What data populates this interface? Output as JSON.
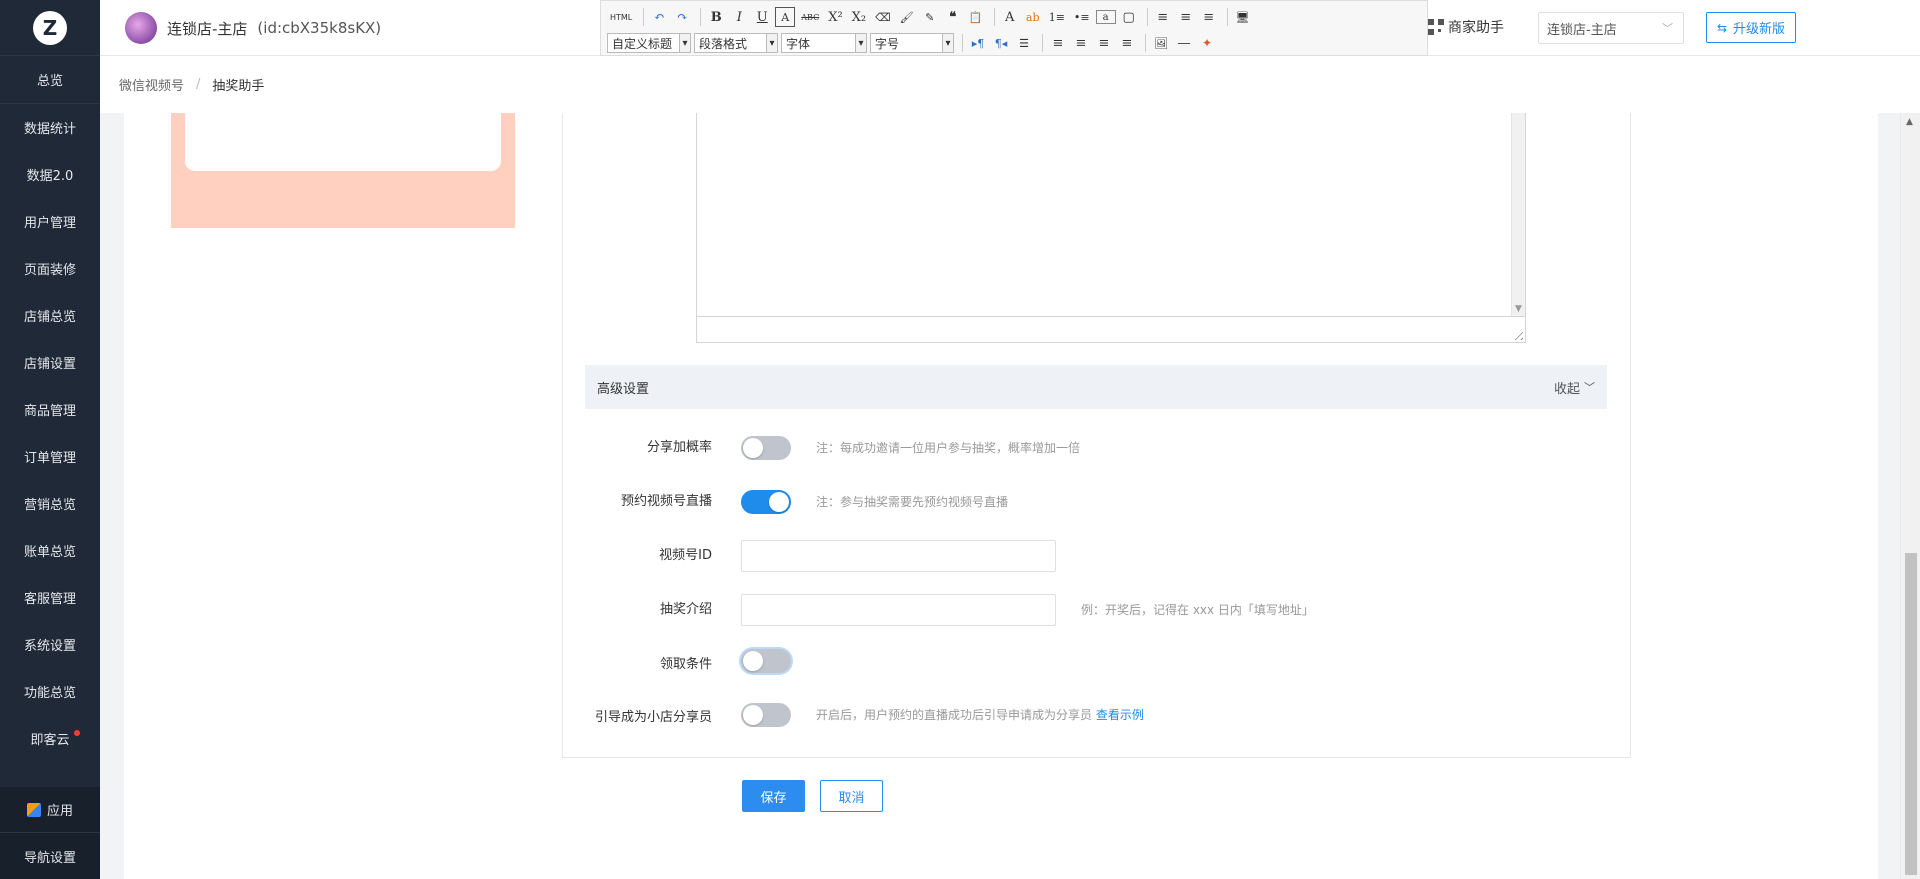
{
  "sidebar": {
    "logo_letter": "Z",
    "items": [
      {
        "label": "总览"
      },
      {
        "label": "数据统计"
      },
      {
        "label": "数据2.0"
      },
      {
        "label": "用户管理"
      },
      {
        "label": "页面装修"
      },
      {
        "label": "店铺总览"
      },
      {
        "label": "店铺设置"
      },
      {
        "label": "商品管理"
      },
      {
        "label": "订单管理"
      },
      {
        "label": "营销总览"
      },
      {
        "label": "账单总览"
      },
      {
        "label": "客服管理"
      },
      {
        "label": "系统设置"
      },
      {
        "label": "功能总览"
      },
      {
        "label": "即客云"
      }
    ],
    "bottom": {
      "app_label": "应用",
      "nav_settings_label": "导航设置"
    }
  },
  "header": {
    "shop_name": "连锁店-主店",
    "shop_id": "(id:cbX35k8sKX)",
    "helper_label": "商家助手",
    "store_selector_value": "连锁店-主店",
    "upgrade_label": "升级新版"
  },
  "editor_toolbar": {
    "row1": [
      "HTML",
      "↶",
      "↷",
      "B",
      "I",
      "U",
      "A",
      "ABC",
      "X²",
      "X₂",
      "⌫",
      "🖌",
      "✎",
      "❝",
      "📋",
      "A",
      "ab",
      "1≡",
      "•≡",
      "a",
      "▢",
      "≡",
      "≡",
      "≡",
      "🖥"
    ],
    "row2_selects": [
      "自定义标题",
      "段落格式",
      "字体",
      "字号"
    ],
    "row2_buttons": [
      "▸¶",
      "¶◂",
      "☰",
      "≡",
      "≡",
      "≡",
      "≡",
      "🖼",
      "—",
      "✦"
    ]
  },
  "breadcrumb": {
    "parent": "微信视频号",
    "separator": "/",
    "current": "抽奖助手"
  },
  "advanced": {
    "title": "高级设置",
    "collapse_label": "收起"
  },
  "fields": {
    "share_boost": {
      "label": "分享加概率",
      "on": false,
      "note": "注：每成功邀请一位用户参与抽奖，概率增加一倍"
    },
    "reserve_live": {
      "label": "预约视频号直播",
      "on": true,
      "note": "注：参与抽奖需要先预约视频号直播"
    },
    "channel_id": {
      "label": "视频号ID",
      "value": "",
      "placeholder": ""
    },
    "intro": {
      "label": "抽奖介绍",
      "value": "",
      "placeholder": "",
      "note": "例：开奖后，记得在 xxx 日内「填写地址」"
    },
    "claim_condition": {
      "label": "领取条件",
      "on": false
    },
    "guide_sharer": {
      "label": "引导成为小店分享员",
      "on": false,
      "note": "开启后，用户预约的直播成功后引导申请成为分享员",
      "link": "查看示例"
    }
  },
  "actions": {
    "save_label": "保存",
    "cancel_label": "取消"
  },
  "colors": {
    "primary": "#1f8ceb",
    "sidebar_bg": "#1f2937",
    "preview_bg": "#ffcfc0"
  }
}
